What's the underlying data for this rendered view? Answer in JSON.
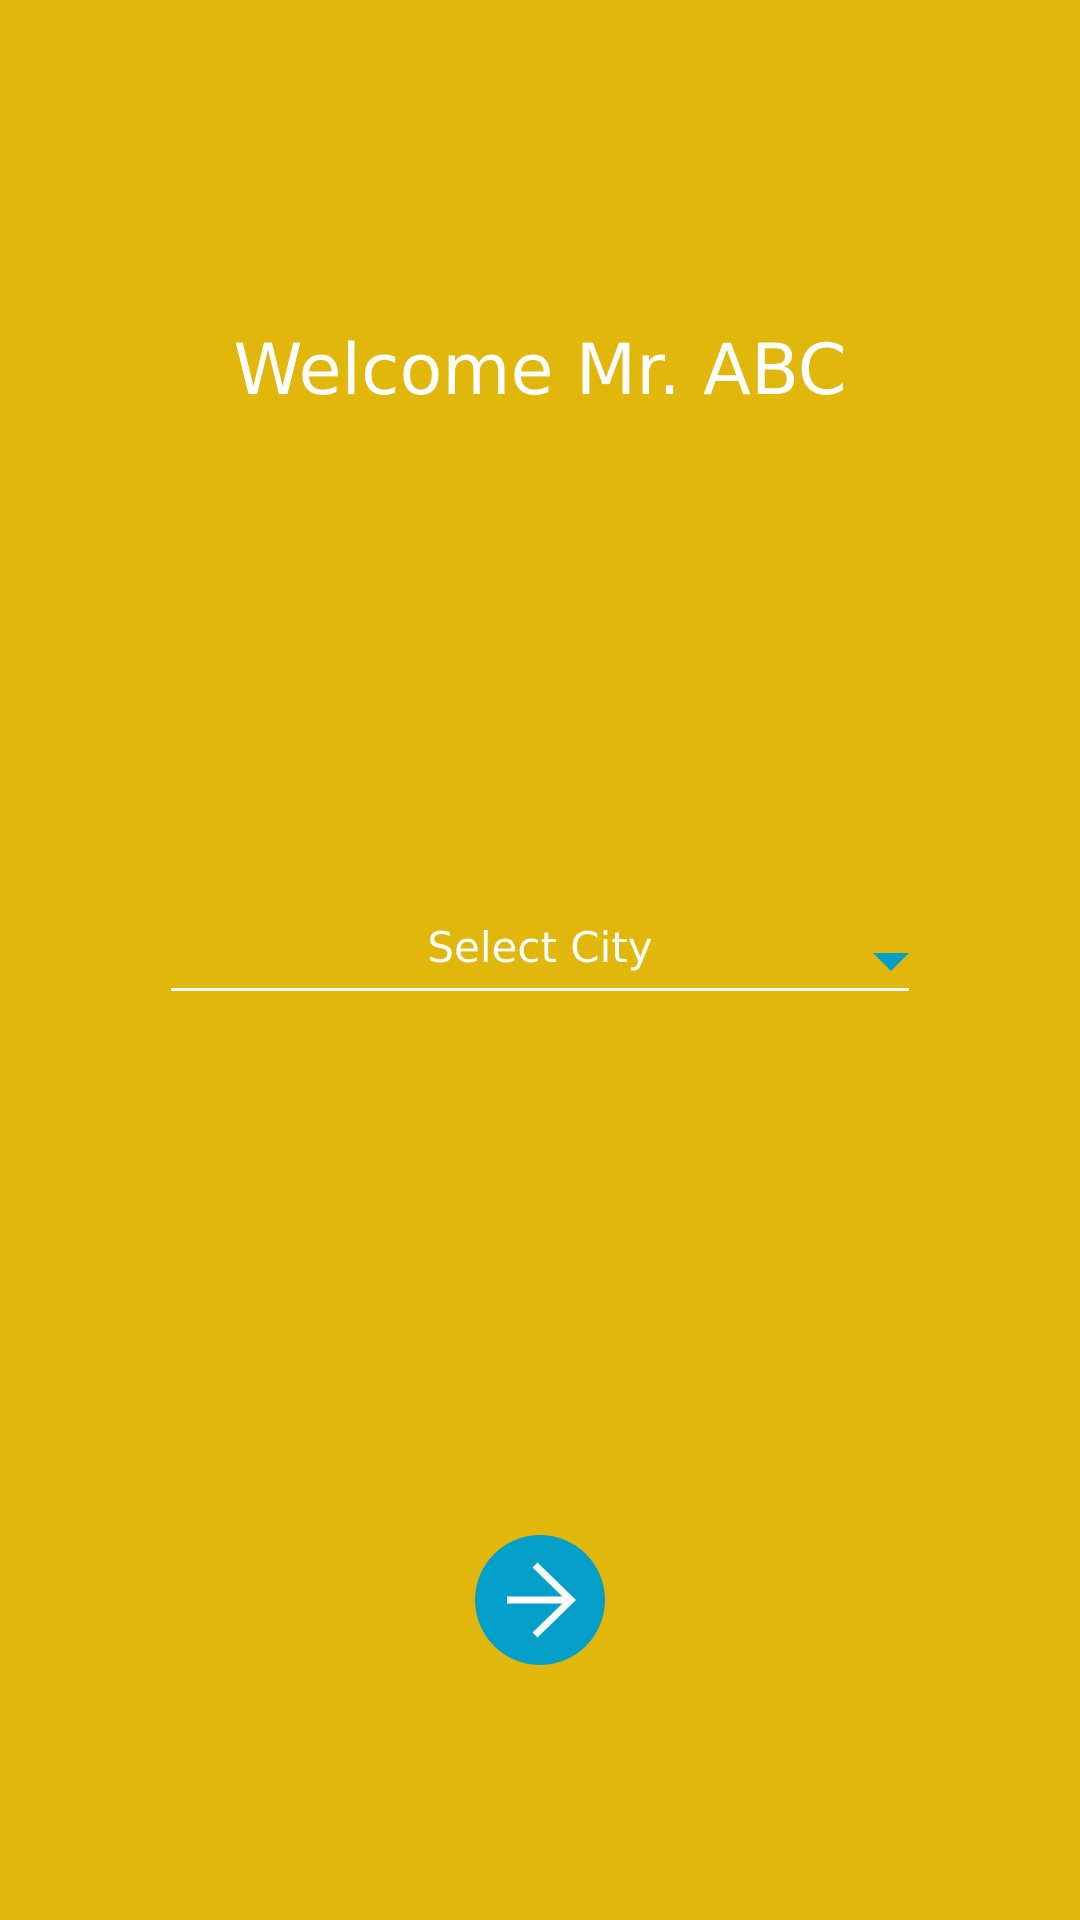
{
  "welcome": {
    "title": "Welcome Mr. ABC"
  },
  "city_select": {
    "selected_label": "Select City",
    "icon": "chevron-down-icon",
    "icon_color": "#049FC9"
  },
  "next_button": {
    "icon": "arrow-right-icon",
    "color": "#049FC9"
  },
  "theme": {
    "background": "#E0B70A",
    "text": "#FFFFFF",
    "accent": "#049FC9"
  }
}
